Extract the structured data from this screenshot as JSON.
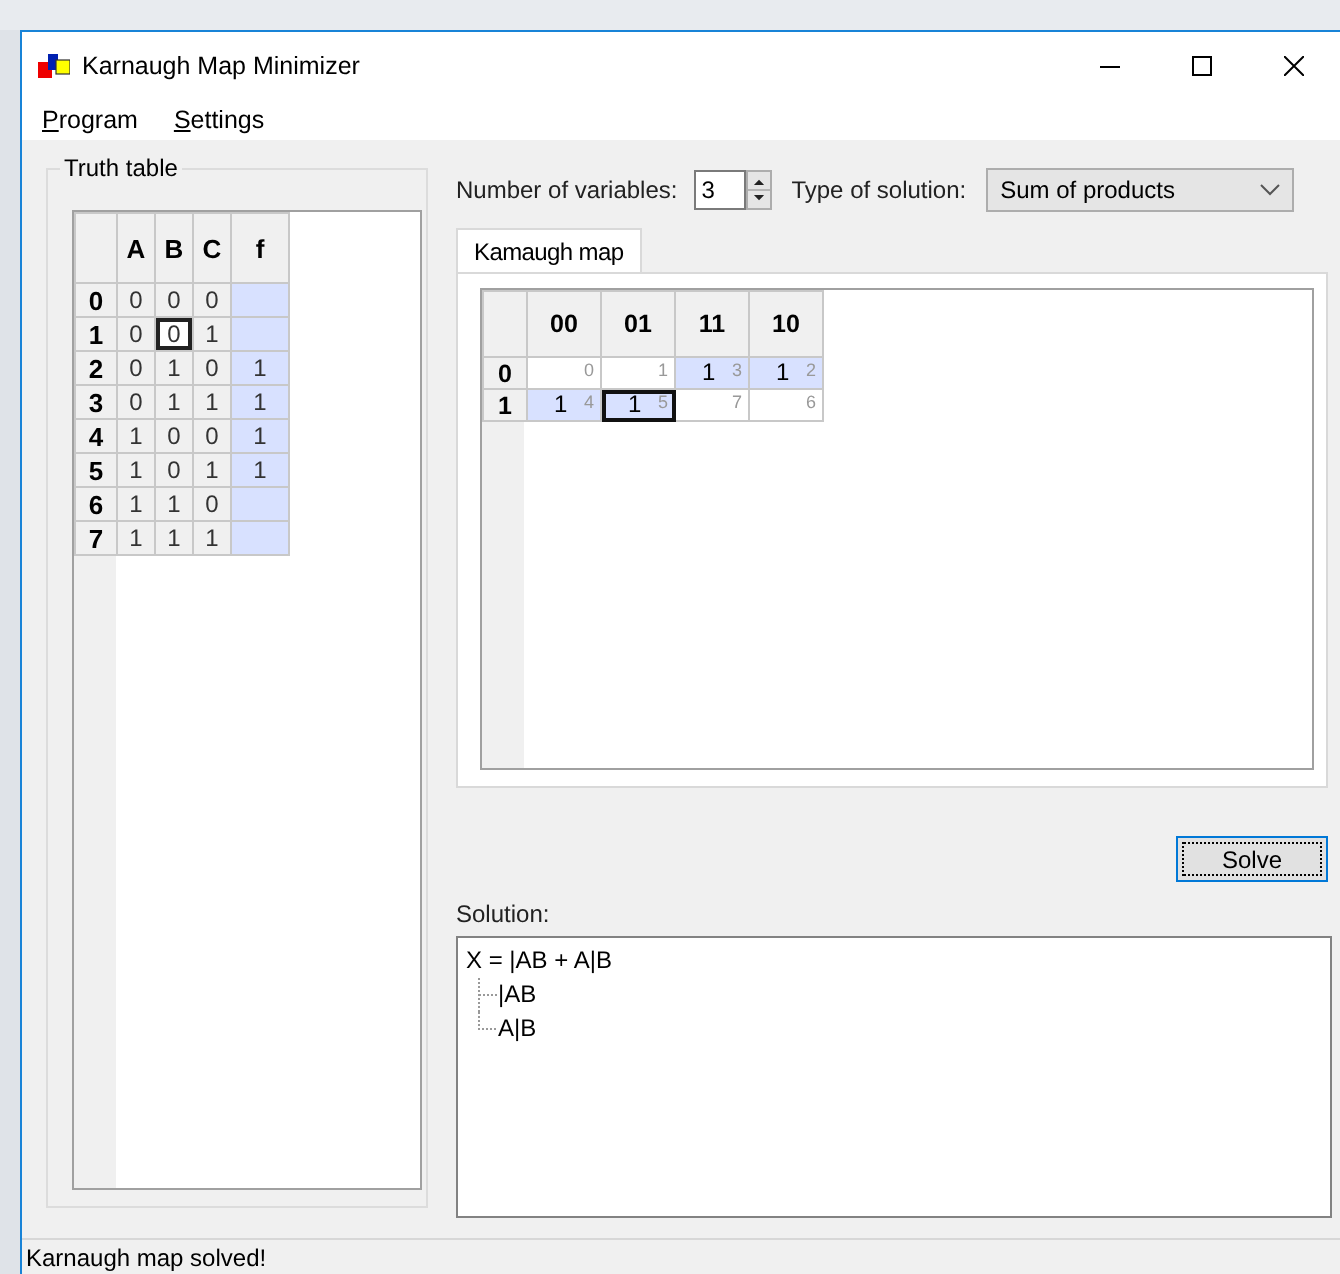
{
  "window": {
    "title": "Karnaugh Map Minimizer"
  },
  "menu": [
    {
      "label": "Program"
    },
    {
      "label": "Settings"
    }
  ],
  "truth_table": {
    "title": "Truth table",
    "columns": [
      "A",
      "B",
      "C",
      "f"
    ],
    "rows": [
      {
        "label": "0",
        "inputs": [
          {
            "value": "0",
            "selected": false
          },
          {
            "value": "0",
            "selected": false
          },
          {
            "value": "0",
            "selected": false
          }
        ]
      },
      {
        "label": "1",
        "inputs": [
          {
            "value": "0",
            "selected": false
          },
          {
            "value": "0",
            "selected": true
          },
          {
            "value": "1",
            "selected": false
          }
        ]
      },
      {
        "label": "2",
        "inputs": [
          {
            "value": "0",
            "selected": false
          },
          {
            "value": "1",
            "selected": false
          },
          {
            "value": "0",
            "selected": false
          }
        ],
        "f": "1"
      },
      {
        "label": "3",
        "inputs": [
          {
            "value": "0",
            "selected": false
          },
          {
            "value": "1",
            "selected": false
          },
          {
            "value": "1",
            "selected": false
          }
        ],
        "f": "1"
      },
      {
        "label": "4",
        "inputs": [
          {
            "value": "1",
            "selected": false
          },
          {
            "value": "0",
            "selected": false
          },
          {
            "value": "0",
            "selected": false
          }
        ],
        "f": "1"
      },
      {
        "label": "5",
        "inputs": [
          {
            "value": "1",
            "selected": false
          },
          {
            "value": "0",
            "selected": false
          },
          {
            "value": "1",
            "selected": false
          }
        ],
        "f": "1"
      },
      {
        "label": "6",
        "inputs": [
          {
            "value": "1",
            "selected": false
          },
          {
            "value": "1",
            "selected": false
          },
          {
            "value": "0",
            "selected": false
          }
        ]
      },
      {
        "label": "7",
        "inputs": [
          {
            "value": "1",
            "selected": false
          },
          {
            "value": "1",
            "selected": false
          },
          {
            "value": "1",
            "selected": false
          }
        ]
      }
    ]
  },
  "variables": {
    "label": "Number of variables:",
    "value": "3"
  },
  "solution_type": {
    "label": "Type of solution:",
    "value": "Sum of products"
  },
  "tabs": [
    {
      "label": "Kamaugh map",
      "selected": true
    }
  ],
  "kmap": {
    "columns": [
      "00",
      "01",
      "11",
      "10"
    ],
    "rows": [
      {
        "label": "0",
        "cells": [
          {
            "index": "0",
            "highlighted": false,
            "selected": false
          },
          {
            "index": "1",
            "highlighted": false,
            "selected": false
          },
          {
            "value": "1",
            "index": "3",
            "highlighted": true,
            "selected": false
          },
          {
            "value": "1",
            "index": "2",
            "highlighted": true,
            "selected": false
          }
        ]
      },
      {
        "label": "1",
        "cells": [
          {
            "value": "1",
            "index": "4",
            "highlighted": true,
            "selected": false
          },
          {
            "value": "1",
            "index": "5",
            "highlighted": true,
            "selected": true
          },
          {
            "index": "7",
            "highlighted": false,
            "selected": false
          },
          {
            "index": "6",
            "highlighted": false,
            "selected": false
          }
        ]
      }
    ]
  },
  "solve_button": "Solve",
  "solution": {
    "label": "Solution:",
    "tree": {
      "text": "X = |AB + A|B",
      "children": [
        {
          "text": "|AB"
        },
        {
          "text": "A|B"
        }
      ]
    }
  },
  "status_bar": "Karnaugh map solved!"
}
